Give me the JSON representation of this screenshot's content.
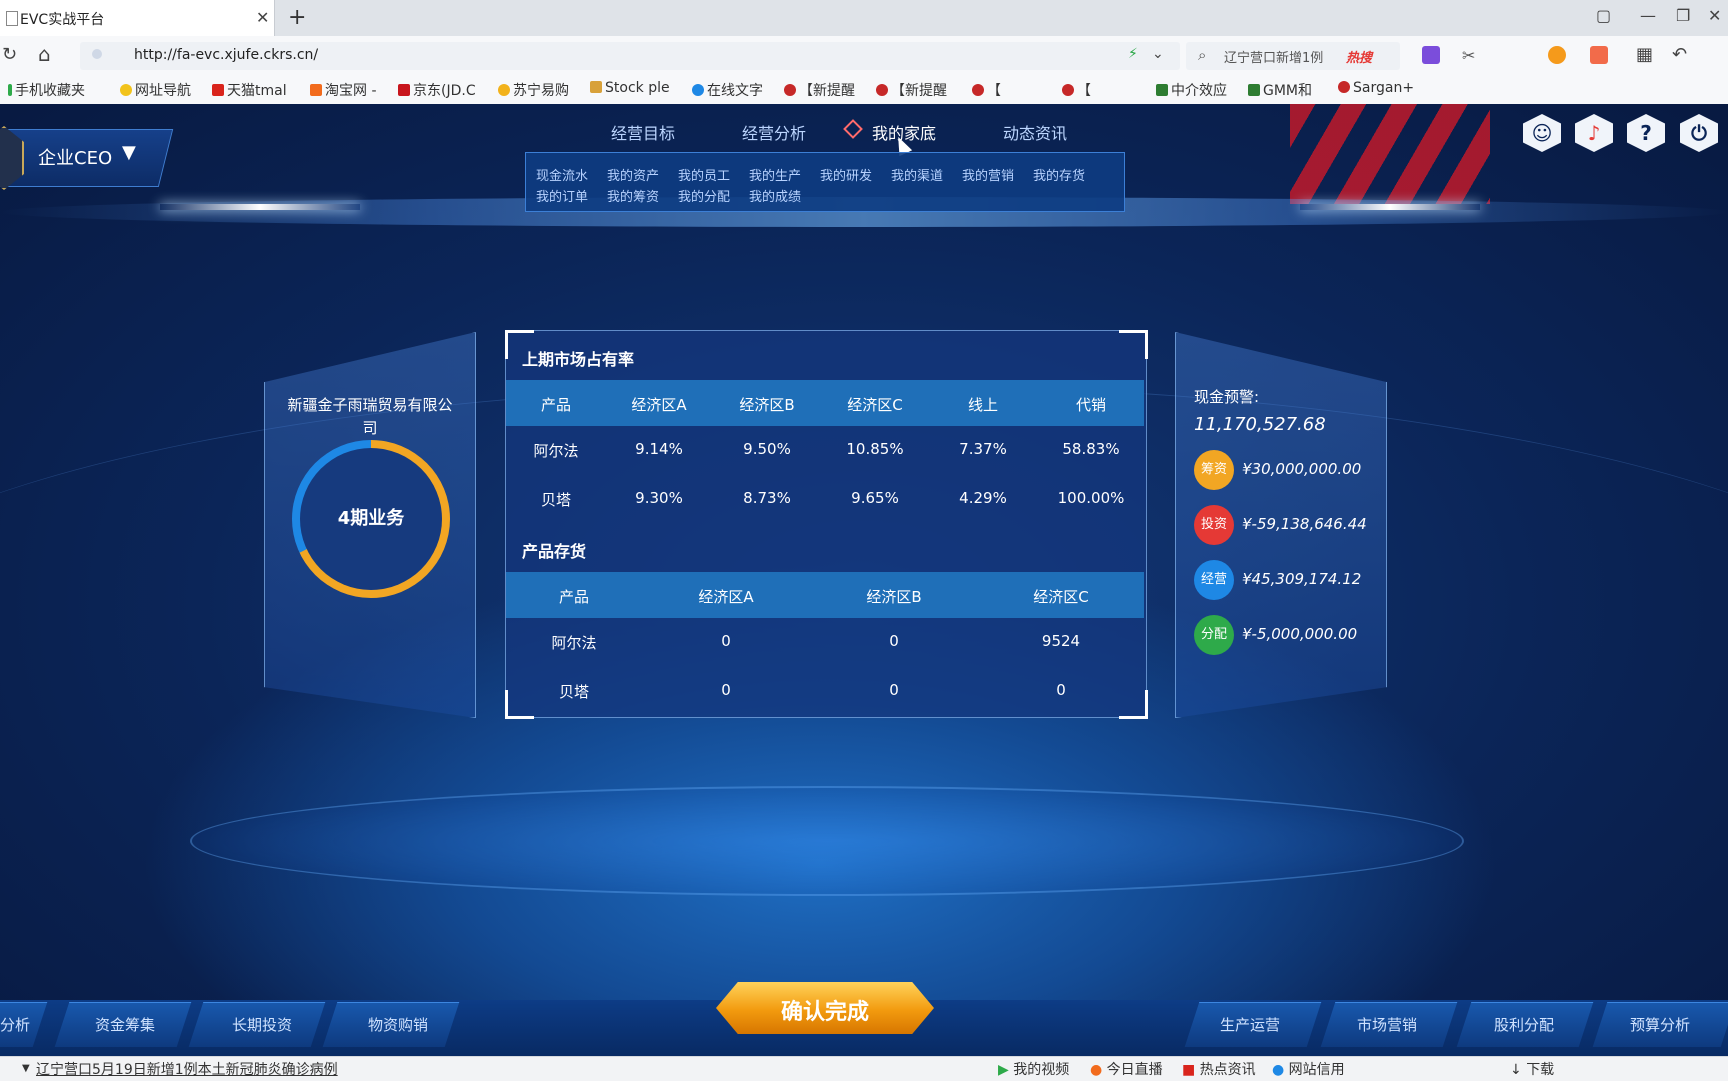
{
  "browser": {
    "tab_title": "EVC实战平台",
    "url": "http://fa-evc.xjufe.ckrs.cn/",
    "search_text": "辽宁营口新增1例",
    "search_hot": "热搜",
    "bookmarks": [
      "手机收藏夹",
      "网址导航",
      "天猫tmal",
      "淘宝网 -",
      "京东(JD.C",
      "苏宁易购",
      "Stock ple",
      "在线文字",
      "【新提醒",
      "【新提醒",
      "【",
      "【",
      "中介效应",
      "GMM和",
      "Sargan+"
    ]
  },
  "role": {
    "label": "企业CEO"
  },
  "nav": {
    "items": [
      "经营目标",
      "经营分析",
      "我的家底",
      "动态资讯"
    ],
    "submenu_row1": [
      "现金流水",
      "我的资产",
      "我的员工",
      "我的生产",
      "我的研发",
      "我的渠道",
      "我的营销",
      "我的存货"
    ],
    "submenu_row2": [
      "我的订单",
      "我的筹资",
      "我的分配",
      "我的成绩"
    ]
  },
  "company": {
    "name": "新疆金子雨瑞贸易有限公司",
    "period_label": "4期业务",
    "progress": 0.68
  },
  "market_share": {
    "title": "上期市场占有率",
    "headers": [
      "产品",
      "经济区A",
      "经济区B",
      "经济区C",
      "线上",
      "代销"
    ],
    "rows": [
      [
        "阿尔法",
        "9.14%",
        "9.50%",
        "10.85%",
        "7.37%",
        "58.83%"
      ],
      [
        "贝塔",
        "9.30%",
        "8.73%",
        "9.65%",
        "4.29%",
        "100.00%"
      ]
    ]
  },
  "inventory": {
    "title": "产品存货",
    "headers": [
      "产品",
      "经济区A",
      "经济区B",
      "经济区C"
    ],
    "rows": [
      [
        "阿尔法",
        "0",
        "0",
        "9524"
      ],
      [
        "贝塔",
        "0",
        "0",
        "0"
      ]
    ]
  },
  "cash": {
    "label": "现金预警:",
    "value": "11,170,527.68",
    "flows": [
      {
        "tag": "筹资",
        "value": "¥30,000,000.00",
        "color": "#f2a623"
      },
      {
        "tag": "投资",
        "value": "¥-59,138,646.44",
        "color": "#e53935"
      },
      {
        "tag": "经营",
        "value": "¥45,309,174.12",
        "color": "#1e88e5"
      },
      {
        "tag": "分配",
        "value": "¥-5,000,000.00",
        "color": "#2eaa4a"
      }
    ]
  },
  "bottom_tabs_left": [
    "分析",
    "资金筹集",
    "长期投资",
    "物资购销"
  ],
  "bottom_tabs_right": [
    "生产运营",
    "市场营销",
    "股利分配",
    "预算分析"
  ],
  "confirm_label": "确认完成",
  "status": {
    "news": "辽宁营口5月19日新增1例本土新冠肺炎确诊病例",
    "items": [
      "我的视频",
      "今日直播",
      "热点资讯",
      "网站信用",
      "下载"
    ]
  }
}
